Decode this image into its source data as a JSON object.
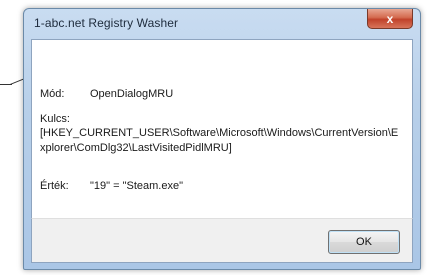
{
  "window": {
    "title": "1-abc.net Registry Washer",
    "close_glyph": "x"
  },
  "fields": {
    "mod_label": "Mód:",
    "mod_value": "OpenDialogMRU",
    "kulcs_label": "Kulcs:",
    "kulcs_value": "[HKEY_CURRENT_USER\\Software\\Microsoft\\Windows\\CurrentVersion\\Explorer\\ComDlg32\\LastVisitedPidlMRU]",
    "ertek_label": "Érték:",
    "ertek_value": "\"19\" = \"Steam.exe\""
  },
  "buttons": {
    "ok_label": "OK"
  },
  "colors": {
    "close_button": "#c0422a",
    "title_bar": "#b7cfe9"
  },
  "icons": [
    "close-icon"
  ]
}
